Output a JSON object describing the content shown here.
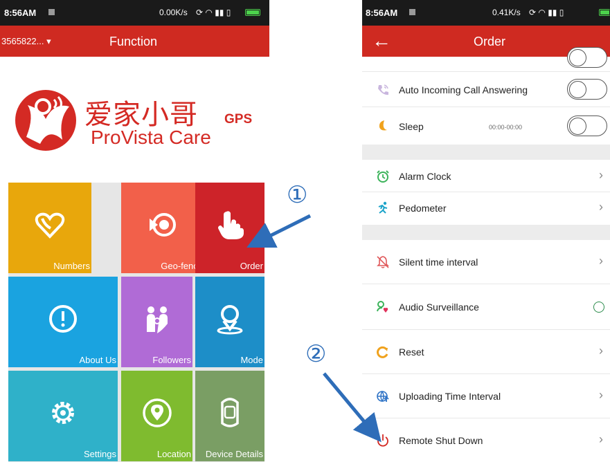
{
  "left": {
    "status": {
      "time": "8:56AM",
      "net": "0.00K/s"
    },
    "device_id": "3565822...",
    "title": "Function",
    "logo": {
      "cn": "爱家小哥",
      "gps": "GPS",
      "en": "ProVista Care"
    },
    "tiles": [
      {
        "label": "Numbers",
        "icon": "heart-phone-icon",
        "color": "#e8a70c"
      },
      {
        "label": "Geo-fence",
        "icon": "fence-target-icon",
        "color": "#f2604a"
      },
      {
        "label": "Order",
        "icon": "hand-pointer-icon",
        "color": "#cd2329"
      },
      {
        "label": "About Us",
        "icon": "info-icon",
        "color": "#1aa3e0"
      },
      {
        "label": "Followers",
        "icon": "family-icon",
        "color": "#b06bd6"
      },
      {
        "label": "Mode",
        "icon": "location-mode-icon",
        "color": "#1d8ec8"
      },
      {
        "label": "Settings",
        "icon": "gear-icon",
        "color": "#2fb1c9"
      },
      {
        "label": "Location",
        "icon": "location-pin-icon",
        "color": "#7fbb2f"
      },
      {
        "label": "Device Details",
        "icon": "watch-icon",
        "color": "#7a9e64"
      }
    ]
  },
  "right": {
    "status": {
      "time": "8:56AM",
      "net": "0.41K/s"
    },
    "title": "Order",
    "rows": {
      "auto_answer": {
        "label": "Auto Incoming Call Answering",
        "icon": "phone-call-icon"
      },
      "sleep": {
        "label": "Sleep",
        "time": "00:00-00:00",
        "icon": "moon-icon"
      },
      "alarm": {
        "label": "Alarm Clock",
        "icon": "alarm-clock-icon"
      },
      "pedometer": {
        "label": "Pedometer",
        "icon": "runner-icon"
      },
      "silent": {
        "label": "Silent time interval",
        "icon": "bell-off-icon"
      },
      "audio": {
        "label": "Audio Surveillance",
        "icon": "listen-icon"
      },
      "reset": {
        "label": "Reset",
        "icon": "reset-icon"
      },
      "upload": {
        "label": "Uploading Time Interval",
        "icon": "globe-upload-icon"
      },
      "shutdown": {
        "label": "Remote Shut Down",
        "icon": "power-icon"
      }
    }
  },
  "annotations": {
    "one": "①",
    "two": "②",
    "color": "#2e6db8"
  }
}
